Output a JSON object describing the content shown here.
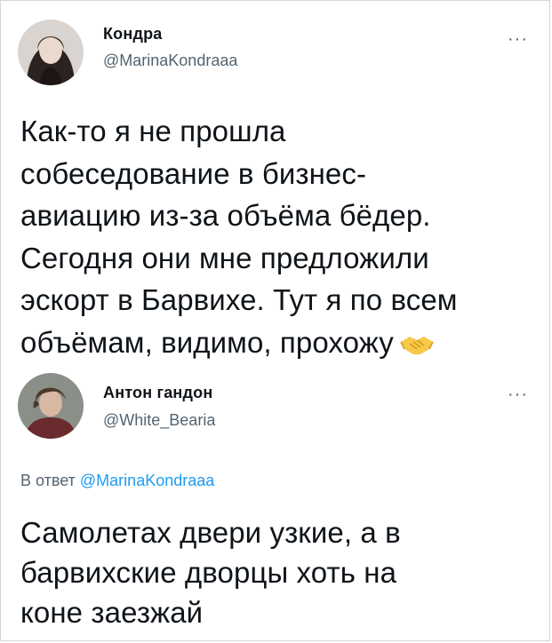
{
  "tweet1": {
    "display_name": "Кондра",
    "handle": "@MarinaKondraaa",
    "more_label": "···",
    "text_lines": [
      "Как-то я не прошла",
      "собеседование в бизнес-",
      "авиацию из-за объёма бёдер.",
      "Сегодня они мне предложили",
      "эскорт в Барвихе. Тут я по всем",
      "объёмам, видимо, прохожу"
    ],
    "emoji": "handshake-icon"
  },
  "tweet2": {
    "display_name": "Антон гандон",
    "handle": "@White_Bearia",
    "more_label": "···",
    "reply_prefix": "В ответ",
    "reply_mention": "@MarinaKondraaa",
    "text_lines": [
      "Самолетах двери узкие, а в",
      "барвихские дворцы хоть на",
      "коне заезжай"
    ]
  },
  "colors": {
    "text": "#0f1419",
    "secondary": "#536471",
    "link": "#1d9bf0"
  }
}
